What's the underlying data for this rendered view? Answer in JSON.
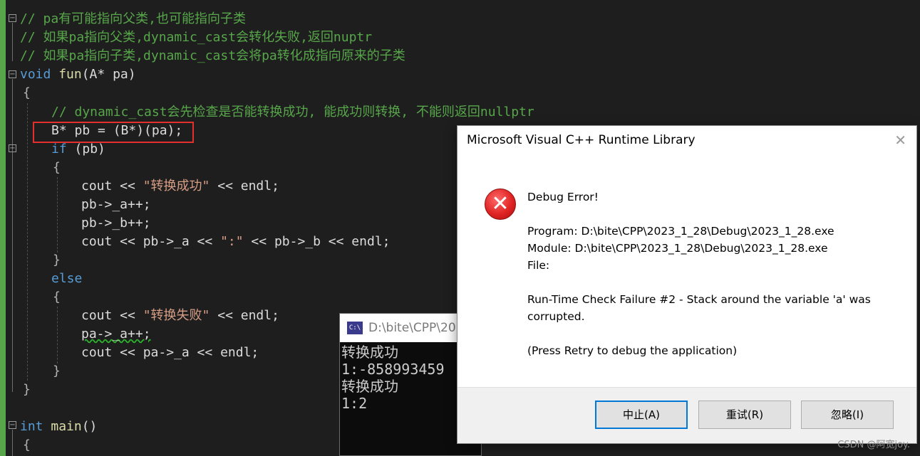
{
  "editor": {
    "lines": {
      "l1": "// pa有可能指向父类,也可能指向子类",
      "l2": "// 如果pa指向父类,dynamic_cast会转化失败,返回nuptr",
      "l3": "// 如果pa指向子类,dynamic_cast会将pa转化成指向原来的子类",
      "l4_kw": "void",
      "l4_fn": "fun",
      "l4_rest": "(A* pa)",
      "l6": "// dynamic_cast会先检查是否能转换成功, 能成功则转换, 不能则返回nullptr",
      "l7": "B* pb = (B*)(pa);",
      "l8_kw": "if",
      "l8_rest": "(pb)",
      "l10_a": "cout << ",
      "l10_s": "\"转换成功\"",
      "l10_b": " << endl;",
      "l11": "pb->_a++;",
      "l12": "pb->_b++;",
      "l13_a": "cout << pb->_a << ",
      "l13_s": "\":\"",
      "l13_b": " << pb->_b << endl;",
      "l15": "else",
      "l17_a": "cout << ",
      "l17_s": "\"转换失败\"",
      "l17_b": " << endl;",
      "l18": "pa->_a++;",
      "l19": "cout << pa->_a << endl;",
      "l23_kw": "int",
      "l23_fn": "main",
      "l23_rest": "()",
      "brace_open": "{",
      "brace_close": "}"
    }
  },
  "console": {
    "title": "D:\\bite\\CPP\\20",
    "output": [
      "转换成功",
      "1:-858993459",
      "转换成功",
      "1:2"
    ]
  },
  "dialog": {
    "title": "Microsoft Visual C++ Runtime Library",
    "close_glyph": "✕",
    "heading": "Debug Error!",
    "program": "Program: D:\\bite\\CPP\\2023_1_28\\Debug\\2023_1_28.exe",
    "module": "Module: D:\\bite\\CPP\\2023_1_28\\Debug\\2023_1_28.exe",
    "file": "File:",
    "failure_1": "Run-Time Check Failure #2 - Stack around the variable 'a' was",
    "failure_2": "corrupted.",
    "hint": "(Press Retry to debug the application)",
    "buttons": {
      "abort": "中止(A)",
      "retry": "重试(R)",
      "ignore": "忽略(I)"
    }
  },
  "watermark": "CSDN @阿宽joy."
}
